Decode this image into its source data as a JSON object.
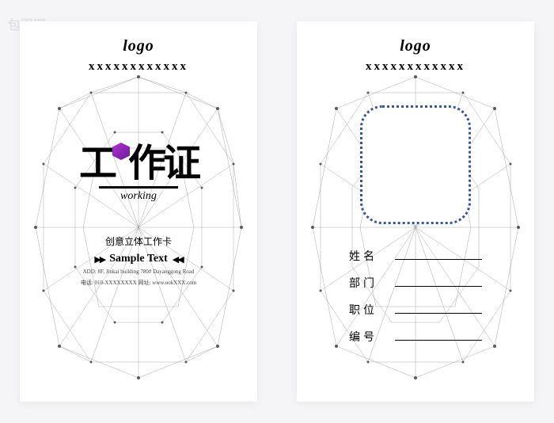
{
  "logo_text": "logo",
  "placeholder_x": "xxxxxxxxxxxx",
  "front": {
    "title_art": "工作证",
    "working": "working",
    "subtitle": "创意立体工作卡",
    "sample_text": "Sample Text",
    "address1": "ADD: 8F, Jinkai building 780# Dayanggong Road",
    "address2": "电话: 010-XXXXXXXX   网址: www.ookXXX.com"
  },
  "back": {
    "fields": [
      {
        "label": "姓名"
      },
      {
        "label": "部门"
      },
      {
        "label": "职位"
      },
      {
        "label": "编号"
      }
    ]
  },
  "watermark_text": "包图网"
}
